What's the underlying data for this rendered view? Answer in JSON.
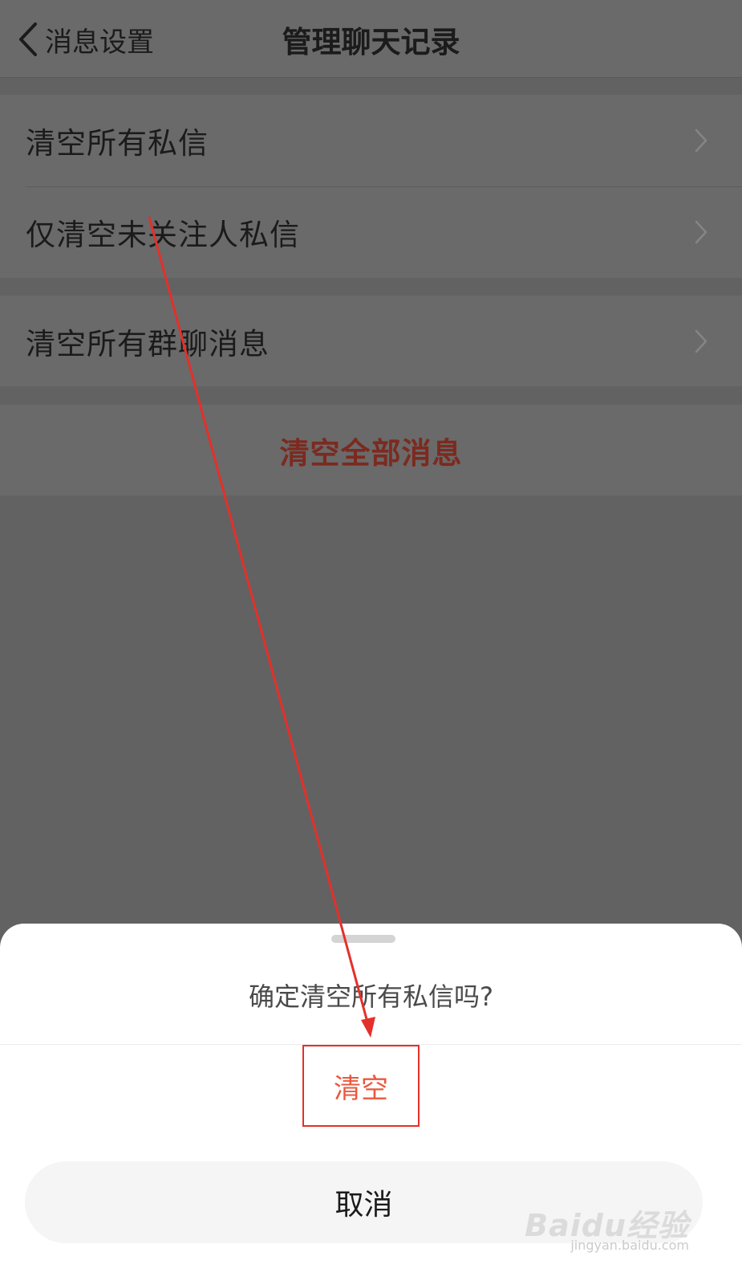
{
  "header": {
    "back_label": "消息设置",
    "title": "管理聊天记录"
  },
  "list": {
    "group1": [
      {
        "label": "清空所有私信"
      },
      {
        "label": "仅清空未关注人私信"
      }
    ],
    "group2": [
      {
        "label": "清空所有群聊消息"
      }
    ],
    "clear_all_label": "清空全部消息"
  },
  "sheet": {
    "prompt": "确定清空所有私信吗?",
    "confirm_label": "清空",
    "cancel_label": "取消"
  },
  "watermark": {
    "logo": "Baidu经验",
    "url": "jingyan.baidu.com"
  },
  "colors": {
    "accent_red": "#e4302a",
    "confirm_text": "#e85a3f",
    "dim_overlay": "#626262"
  },
  "icons": {
    "back": "chevron-left-icon",
    "row_arrow": "chevron-right-icon",
    "annotation": "red-arrow"
  }
}
